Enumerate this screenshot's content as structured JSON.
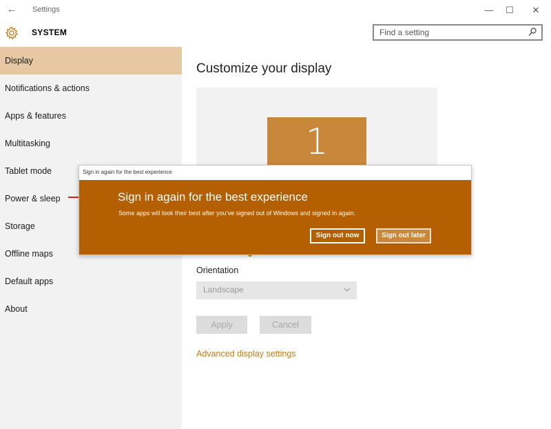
{
  "window": {
    "title": "Settings",
    "back_glyph": "←",
    "minimize_glyph": "—",
    "maximize_glyph": "☐",
    "close_glyph": "✕"
  },
  "header": {
    "icon": "gear-icon",
    "title": "SYSTEM",
    "search_placeholder": "Find a setting"
  },
  "sidebar": {
    "items": [
      {
        "label": "Display",
        "active": true
      },
      {
        "label": "Notifications & actions"
      },
      {
        "label": "Apps & features"
      },
      {
        "label": "Multitasking"
      },
      {
        "label": "Tablet mode"
      },
      {
        "label": "Power & sleep"
      },
      {
        "label": "Storage"
      },
      {
        "label": "Offline maps"
      },
      {
        "label": "Default apps"
      },
      {
        "label": "About"
      }
    ]
  },
  "main": {
    "title": "Customize your display",
    "monitor_number": "1",
    "orientation_label": "Orientation",
    "orientation_value": "Landscape",
    "apply_label": "Apply",
    "cancel_label": "Cancel",
    "advanced_link": "Advanced display settings"
  },
  "dialog": {
    "title_bar": "Sign in again for the best experience",
    "heading": "Sign in again for the best experience",
    "message": "Some apps will look their best after you’ve signed out of Windows and signed in again.",
    "sign_out_now": "Sign out now",
    "sign_out_later": "Sign out later"
  },
  "colors": {
    "accent": "#c57a18",
    "dialog_bg": "#b35f02",
    "active_nav": "#e6c8a2",
    "monitor": "#c9873b",
    "annotation_arrow": "#e02020"
  }
}
